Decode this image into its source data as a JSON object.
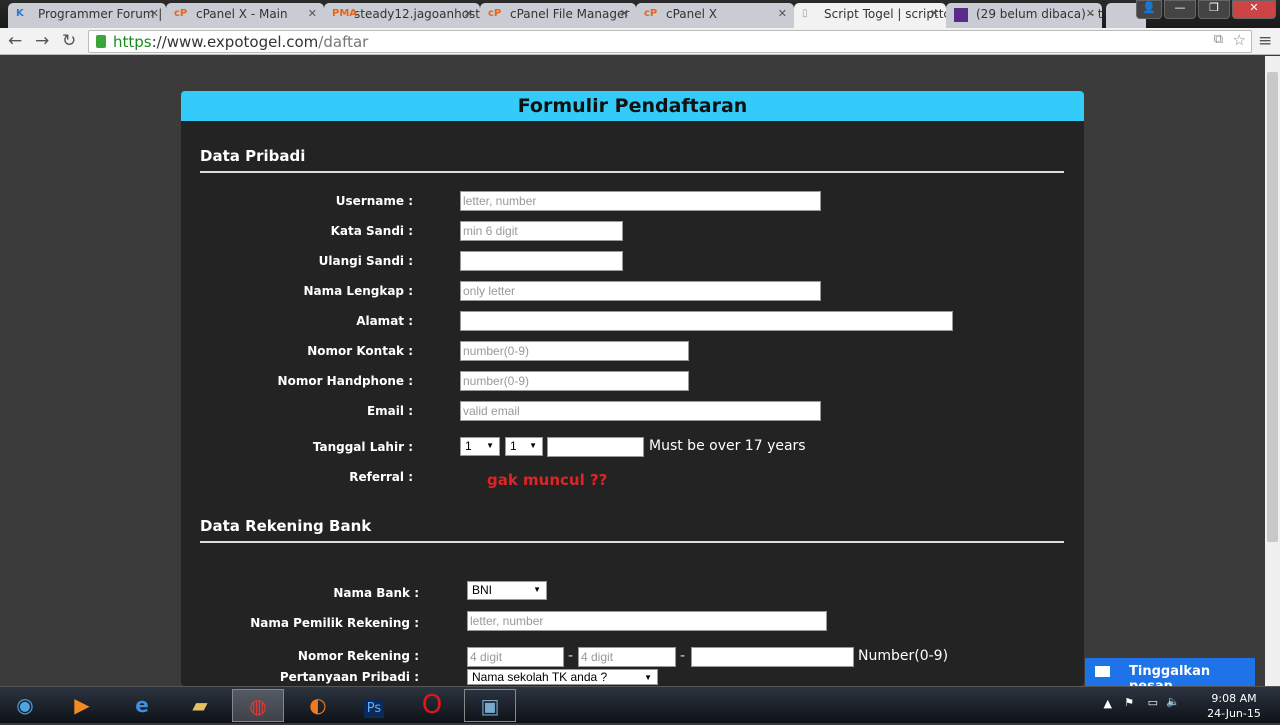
{
  "browser": {
    "tabs": [
      {
        "title": "Programmer Forum |",
        "icon": "kaskus-icon"
      },
      {
        "title": "cPanel X - Main",
        "icon": "cpanel-icon"
      },
      {
        "title": "steady12.jagoanhosti",
        "icon": "phpmyadmin-icon"
      },
      {
        "title": "cPanel File Manager",
        "icon": "cpanel-icon"
      },
      {
        "title": "cPanel X",
        "icon": "cpanel-icon"
      },
      {
        "title": "Script Togel | scripttc",
        "icon": "page-icon"
      },
      {
        "title": "(29 belum dibaca) - t",
        "icon": "mail-icon"
      }
    ],
    "url": {
      "scheme": "https",
      "host": "://www.expotogel.com",
      "path": "/daftar"
    }
  },
  "form": {
    "title": "Formulir Pendaftaran",
    "section1": "Data Pribadi",
    "fields": [
      {
        "label": "Username :",
        "placeholder": "letter, number"
      },
      {
        "label": "Kata Sandi :",
        "placeholder": "min 6 digit"
      },
      {
        "label": "Ulangi Sandi :",
        "placeholder": ""
      },
      {
        "label": "Nama Lengkap :",
        "placeholder": "only letter"
      },
      {
        "label": "Alamat :",
        "placeholder": ""
      },
      {
        "label": "Nomor Kontak :",
        "placeholder": "number(0-9)"
      },
      {
        "label": "Nomor Handphone :",
        "placeholder": "number(0-9)"
      },
      {
        "label": "Email :",
        "placeholder": "valid email"
      }
    ],
    "dob": {
      "label": "Tanggal Lahir :",
      "day": "1",
      "month": "1",
      "note": "Must be over 17 years"
    },
    "referral": {
      "label": "Referral :",
      "annotation": "gak muncul ??"
    },
    "section2": "Data Rekening Bank",
    "bank": {
      "label": "Nama Bank :",
      "value": "BNI"
    },
    "owner": {
      "label": "Nama Pemilik Rekening :",
      "placeholder": "letter, number"
    },
    "account": {
      "label": "Nomor Rekening :",
      "placeholder1": "4 digit",
      "placeholder2": "4 digit",
      "sep": "-",
      "note": "Number(0-9)"
    },
    "question": {
      "label": "Pertanyaan Pribadi :",
      "value": "Nama sekolah TK anda ?"
    }
  },
  "chat": {
    "label": "Tinggalkan pesan"
  },
  "taskbar": {
    "time": "9:08 AM",
    "date": "24-Jun-15",
    "ps": "Ps"
  }
}
